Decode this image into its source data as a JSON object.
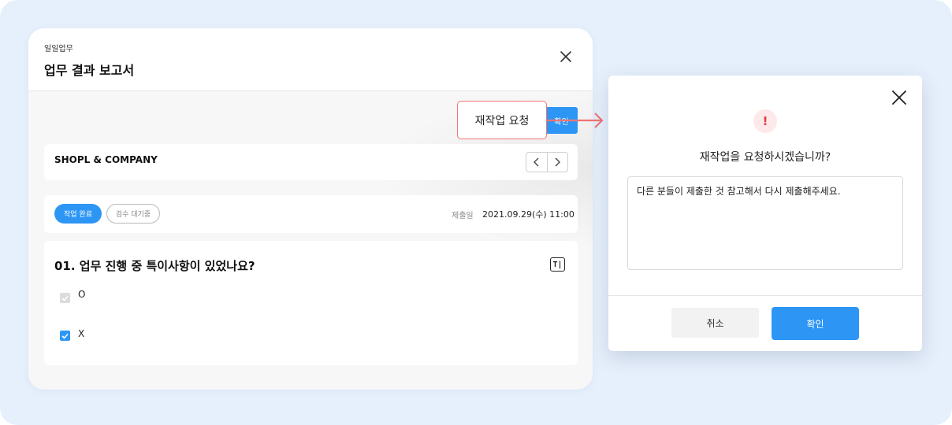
{
  "panel": {
    "breadcrumb": "일일업무",
    "title": "업무 결과 보고서",
    "confirm_label": "확인",
    "company": "SHOPL & COMPANY",
    "badges": {
      "done": "작업 완료",
      "waiting": "검수 대기중"
    },
    "submit_label": "제출일",
    "submit_date": "2021.09.29(수) 11:00",
    "question": {
      "title": "01. 업무 진행 중 특이사항이 있었나요?",
      "type_icon_glyph": "T|",
      "options": [
        {
          "label": "O",
          "checked": false,
          "disabled": true
        },
        {
          "label": "X",
          "checked": true,
          "disabled": false
        }
      ]
    }
  },
  "callout": {
    "label": "재작업 요청"
  },
  "modal": {
    "question": "재작업을 요청하시겠습니까?",
    "message": "다른 분들이 제출한 것 참고해서 다시 제출해주세요.",
    "cancel_label": "취소",
    "confirm_label": "확인"
  },
  "colors": {
    "background": "#e6f0fc",
    "primary": "#2d96f5",
    "callout_border": "#f07474",
    "alert": "#e43b3b"
  }
}
